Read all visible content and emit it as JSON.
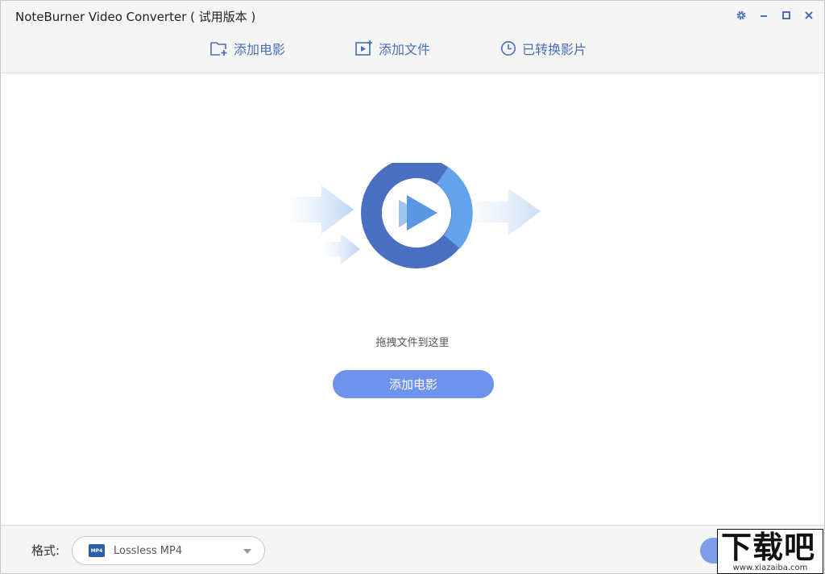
{
  "app": {
    "title": "NoteBurner Video Converter ( 试用版本 )"
  },
  "window_controls": {
    "settings_icon": "gear-icon",
    "minimize_icon": "minimize-icon",
    "maximize_icon": "maximize-icon",
    "close_icon": "close-icon"
  },
  "toolbar": {
    "add_movie_label": "添加电影",
    "add_file_label": "添加文件",
    "converted_label": "已转换影片"
  },
  "main": {
    "drop_hint": "拖拽文件到这里",
    "add_button_label": "添加电影"
  },
  "footer": {
    "format_label": "格式:",
    "format_icon_text": "MP4",
    "format_value": "Lossless MP4"
  },
  "watermark": {
    "logo_text": "下载吧",
    "url_text": "www.xiazaiba.com"
  },
  "colors": {
    "accent": "#4a6fb5",
    "button": "#6d93ec",
    "ring_dark": "#4a6ec0",
    "ring_light": "#64a4ec"
  }
}
